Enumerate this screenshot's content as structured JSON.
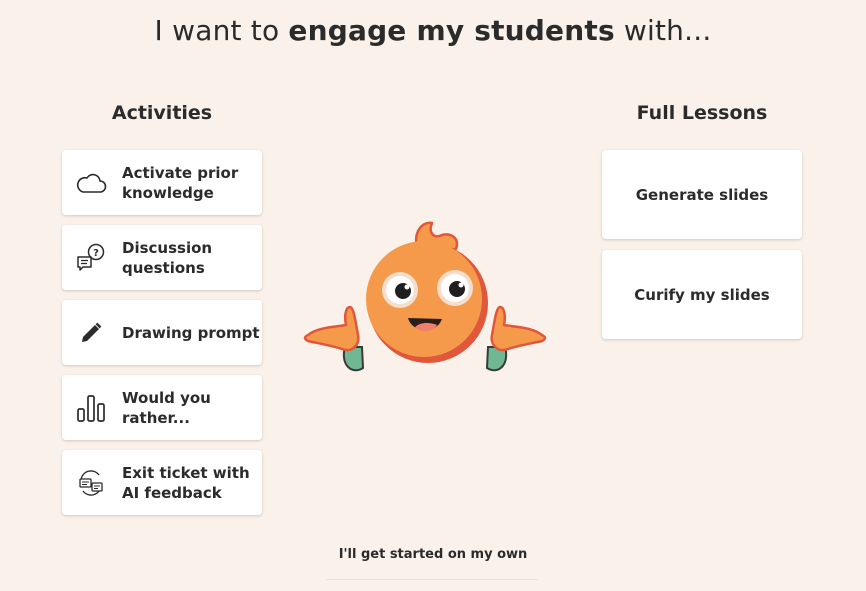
{
  "header": {
    "title_pre": "I want to ",
    "title_bold": "engage my students",
    "title_post": " with..."
  },
  "activities": {
    "title": "Activities",
    "items": [
      {
        "label": "Activate prior\nknowledge",
        "icon": "cloud-icon"
      },
      {
        "label": "Discussion\nquestions",
        "icon": "chat-question-icon"
      },
      {
        "label": "Drawing prompt",
        "icon": "pencil-icon"
      },
      {
        "label": "Would you\nrather...",
        "icon": "bar-chart-icon"
      },
      {
        "label": "Exit ticket with\nAI feedback",
        "icon": "feedback-loop-icon"
      }
    ]
  },
  "lessons": {
    "title": "Full Lessons",
    "items": [
      {
        "label": "Generate slides"
      },
      {
        "label": "Curify my slides"
      }
    ]
  },
  "footer": {
    "link": "I'll get started on my own"
  },
  "colors": {
    "background": "#f9f1ea",
    "card": "#ffffff",
    "text": "#2b2b2b",
    "mascot_body": "#f59a4b",
    "mascot_shadow": "#e0573b",
    "sleeve": "#6fb893"
  }
}
